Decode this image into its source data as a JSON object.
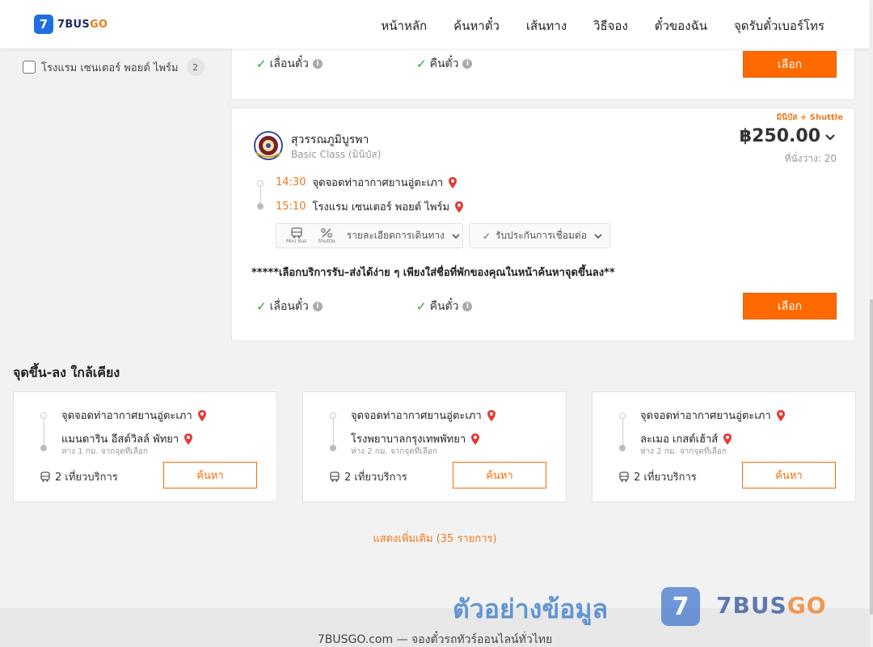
{
  "header": {
    "logo_mark": "7",
    "logo_text_a": "7BUS",
    "logo_text_b": "GO",
    "nav": [
      "หน้าหลัก",
      "ค้นหาตั๋ว",
      "เส้นทาง",
      "วิธีจอง",
      "ตั๋วของฉัน",
      "จุดรับตั๋วเบอร์โทร"
    ]
  },
  "filter": {
    "label": "โรงแรม เซนเตอร์ พอยต์ ไพร์ม",
    "count": "2",
    "checked": false
  },
  "card_top": {
    "reschedule": "เลื่อนตั๋ว",
    "refund": "คืนตั๋ว",
    "select_label": "เลือก"
  },
  "trip": {
    "tag": "มินิบัส + Shuttle",
    "operator": "สุวรรณภูมิบูรพา",
    "class": "Basic Class (มินิบัส)",
    "price": "฿250.00",
    "seats": "ที่นั่งว่าง: 20",
    "depart_time": "14:30",
    "depart_place": "จุดจอดท่าอากาศยานอู่ตะเภา",
    "arrive_time": "15:10",
    "arrive_place": "โรงแรม เซนเตอร์ พอยต์ ไพร์ม",
    "icon_minibus": "Mini Bus",
    "icon_shuttle": "Shuttle",
    "details_label": "รายละเอียดการเดินทาง",
    "insurance_label": "รับประกันการเชื่อมต่อ",
    "notice": "*****เลือกบริการรับ–ส่งได้ง่าย ๆ เพียงใส่ชื่อที่พักของคุณในหน้าค้นหาจุดขึ้นลง**",
    "reschedule": "เลื่อนตั๋ว",
    "refund": "คืนตั๋ว",
    "select_label": "เลือก"
  },
  "nearby": {
    "title": "จุดขึ้น-ลง ใกล้เคียง",
    "cards": [
      {
        "from": "จุดจอดท่าอากาศยานอู่ตะเภา",
        "to": "แมนดาริน อีสต์วิลล์ พัทยา",
        "distance": "ห่าง 1 กม. จากจุดที่เลือก",
        "trips": "2 เที่ยวบริการ",
        "button": "ค้นหา"
      },
      {
        "from": "จุดจอดท่าอากาศยานอู่ตะเภา",
        "to": "โรงพยาบาลกรุงเทพพัทยา",
        "distance": "ห่าง 2 กม. จากจุดที่เลือก",
        "trips": "2 เที่ยวบริการ",
        "button": "ค้นหา"
      },
      {
        "from": "จุดจอดท่าอากาศยานอู่ตะเภา",
        "to": "ละเมอ เกสต์เฮ้าส์",
        "distance": "ห่าง 2 กม. จากจุดที่เลือก",
        "trips": "2 เที่ยวบริการ",
        "button": "ค้นหา"
      }
    ],
    "show_more": "แสดงเพิ่มเติม (35 รายการ)"
  },
  "footer": {
    "text": "7BUSGO.com — จองตั๋วรถทัวร์ออนไลน์ทั่วไทย",
    "watermark": "ตัวอย่างข้อมูล",
    "wm_logo_mark": "7",
    "wm_logo_a": "7BUS",
    "wm_logo_b": "GO"
  },
  "colors": {
    "accent": "#ff6a00",
    "brand_blue": "#1f6fe0",
    "check_green": "#2e9d3f",
    "pin_red": "#e53935"
  }
}
